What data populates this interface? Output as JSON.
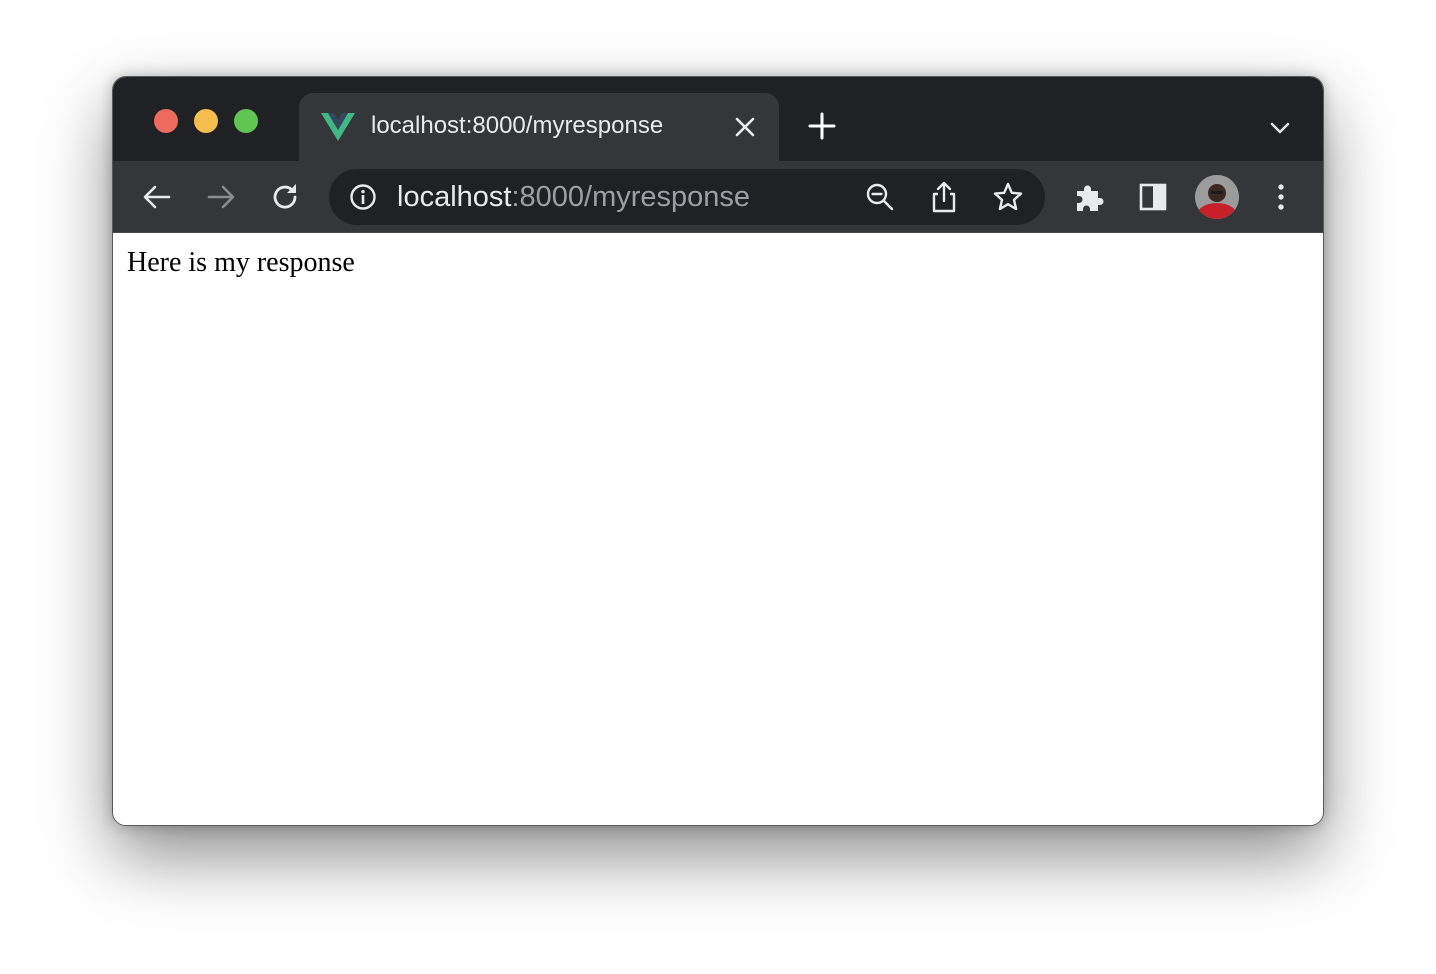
{
  "browser": {
    "tab": {
      "title": "localhost:8000/myresponse",
      "favicon": "vue-logo-icon"
    },
    "address_bar": {
      "host": "localhost",
      "rest": ":8000/myresponse"
    },
    "toolbar_icons": [
      "back-icon",
      "forward-icon",
      "reload-icon",
      "site-info-icon",
      "zoom-out-icon",
      "share-icon",
      "bookmark-star-icon",
      "extensions-icon",
      "side-panel-icon",
      "profile-avatar",
      "more-menu-icon"
    ],
    "colors": {
      "titlebar": "#202124",
      "toolbar": "#35363a",
      "close": "#ed6a5e",
      "minimize": "#f5bf4f",
      "maximize": "#61c554",
      "vue_green": "#41b883",
      "vue_dark": "#35495e"
    }
  },
  "page": {
    "body_text": "Here is my response"
  }
}
